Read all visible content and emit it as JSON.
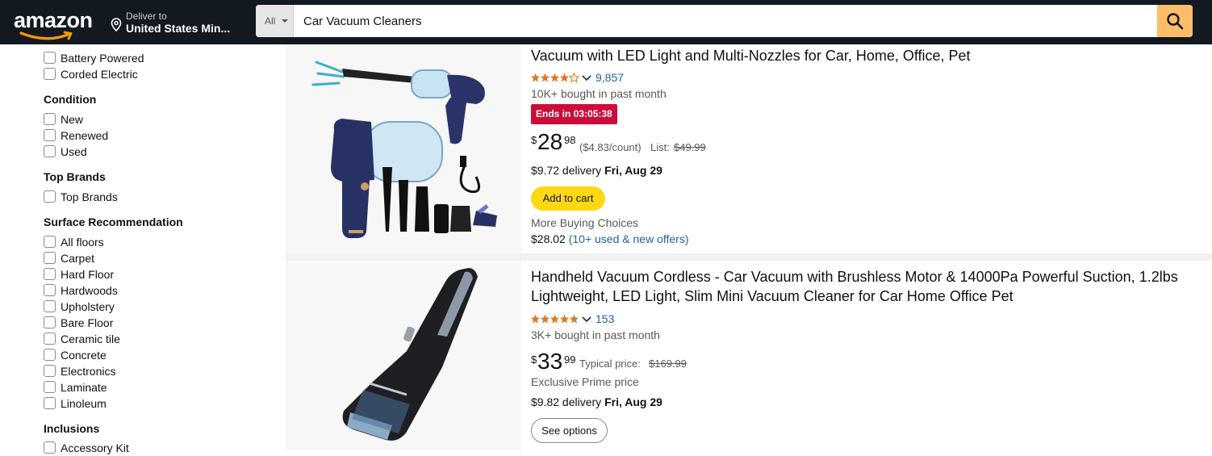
{
  "header": {
    "logo_text": "amazon",
    "deliver_line1": "Deliver to",
    "deliver_line2": "United States Min...",
    "search_dept": "All",
    "search_value": "Car Vacuum Cleaners",
    "colors": {
      "bar": "#131921",
      "search_button": "#febd69"
    }
  },
  "sidebar": {
    "top_items": [
      "Battery Powered",
      "Corded Electric"
    ],
    "condition": {
      "heading": "Condition",
      "items": [
        "New",
        "Renewed",
        "Used"
      ]
    },
    "top_brands": {
      "heading": "Top Brands",
      "items": [
        "Top Brands"
      ]
    },
    "surface": {
      "heading": "Surface Recommendation",
      "items": [
        "All floors",
        "Carpet",
        "Hard Floor",
        "Hardwoods",
        "Upholstery",
        "Bare Floor",
        "Ceramic tile",
        "Concrete",
        "Electronics",
        "Laminate",
        "Linoleum"
      ]
    },
    "inclusions": {
      "heading": "Inclusions",
      "items": [
        "Accessory Kit"
      ]
    }
  },
  "products": [
    {
      "title": "Vacuum with LED Light and Multi-Nozzles for Car, Home, Office, Pet",
      "rating_stars": 4.0,
      "rating_count": "9,857",
      "bought": "10K+ bought in past month",
      "deal_badge": "Ends in 03:05:38",
      "price_symbol": "$",
      "price_whole": "28",
      "price_fraction": "98",
      "unit_price": "($4.83/count)",
      "list_label": "List:",
      "list_price": "$49.99",
      "delivery_fee": "$9.72 delivery",
      "delivery_date": "Fri, Aug 29",
      "button_label": "Add to cart",
      "more_buying": "More Buying Choices",
      "offers_price": "$28.02",
      "offers_link": "(10+ used & new offers)"
    },
    {
      "title_line1": "Handheld Vacuum Cordless - Car Vacuum with Brushless Motor & 14000Pa Powerful Suction, 1.2lbs",
      "title_line2": "Lightweight, LED Light, Slim Mini Vacuum Cleaner for Car Home Office Pet",
      "rating_stars": 5.0,
      "rating_count": "153",
      "bought": "3K+ bought in past month",
      "price_symbol": "$",
      "price_whole": "33",
      "price_fraction": "99",
      "typical_label": "Typical price:",
      "typical_price": "$169.99",
      "exclusive": "Exclusive Prime price",
      "delivery_fee": "$9.82 delivery",
      "delivery_date": "Fri, Aug 29",
      "button_label": "See options"
    }
  ],
  "colors": {
    "deal_badge": "#cc0c39",
    "add_to_cart": "#ffd814",
    "star": "#de7921",
    "link": "#2162a1"
  }
}
